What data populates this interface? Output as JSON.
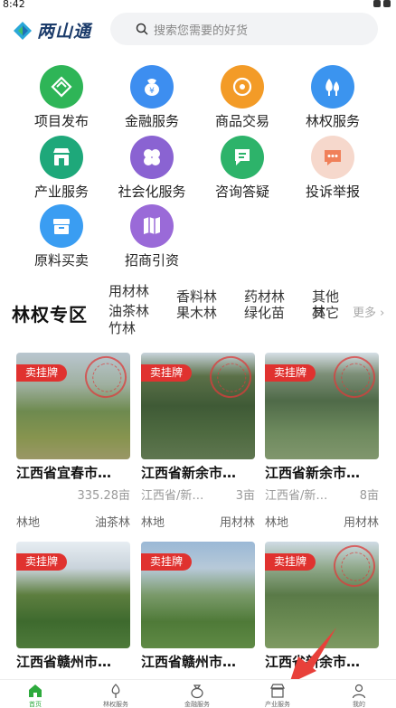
{
  "status": {
    "time": "8:42"
  },
  "header": {
    "brand": "两山通",
    "search_placeholder": "搜索您需要的好货"
  },
  "categories": [
    {
      "label": "项目发布",
      "icon": "project-publish-icon",
      "color": "#2eb557"
    },
    {
      "label": "金融服务",
      "icon": "finance-icon",
      "color": "#3d8ef0"
    },
    {
      "label": "商品交易",
      "icon": "trade-icon",
      "color": "#f39b27"
    },
    {
      "label": "林权服务",
      "icon": "forest-icon",
      "color": "#3b94ef"
    },
    {
      "label": "产业服务",
      "icon": "industry-shop-icon",
      "color": "#1ea87a"
    },
    {
      "label": "社会化服务",
      "icon": "social-service-icon",
      "color": "#8a63d2"
    },
    {
      "label": "咨询答疑",
      "icon": "consult-icon",
      "color": "#2db36a"
    },
    {
      "label": "投诉举报",
      "icon": "complaint-icon",
      "color": "#f0805a"
    },
    {
      "label": "原料买卖",
      "icon": "material-icon",
      "color": "#3a9df2"
    },
    {
      "label": "招商引资",
      "icon": "investment-icon",
      "color": "#9a6ad8"
    }
  ],
  "zone": {
    "title": "林权专区",
    "tags": [
      "用材林",
      "香料林",
      "药材林",
      "其他林",
      "油茶林",
      "果木林",
      "绿化苗",
      "其它",
      "竹林"
    ],
    "more": "更多"
  },
  "listings": [
    {
      "badge": "卖挂牌",
      "title": "江西省宜春市…",
      "location": "",
      "area": "335.28亩",
      "land": "林地",
      "forest": "油茶林"
    },
    {
      "badge": "卖挂牌",
      "title": "江西省新余市…",
      "location": "江西省/新…",
      "area": "3亩",
      "land": "林地",
      "forest": "用材林"
    },
    {
      "badge": "卖挂牌",
      "title": "江西省新余市…",
      "location": "江西省/新…",
      "area": "8亩",
      "land": "林地",
      "forest": "用材林"
    },
    {
      "badge": "卖挂牌",
      "title": "江西省赣州市…",
      "location": "",
      "area": "",
      "land": "",
      "forest": ""
    },
    {
      "badge": "卖挂牌",
      "title": "江西省赣州市…",
      "location": "",
      "area": "",
      "land": "",
      "forest": ""
    },
    {
      "badge": "卖挂牌",
      "title": "江西省新余市…",
      "location": "",
      "area": "",
      "land": "",
      "forest": ""
    }
  ],
  "nav": [
    {
      "label": "首页",
      "icon": "home-icon",
      "active": true
    },
    {
      "label": "林权服务",
      "icon": "tree-icon",
      "active": false
    },
    {
      "label": "金融服务",
      "icon": "money-bag-icon",
      "active": false
    },
    {
      "label": "产业服务",
      "icon": "shop-icon",
      "active": false
    },
    {
      "label": "我的",
      "icon": "user-icon",
      "active": false
    }
  ],
  "colors": {
    "accent_green": "#2eaa3d",
    "badge_red": "#e0322f"
  }
}
